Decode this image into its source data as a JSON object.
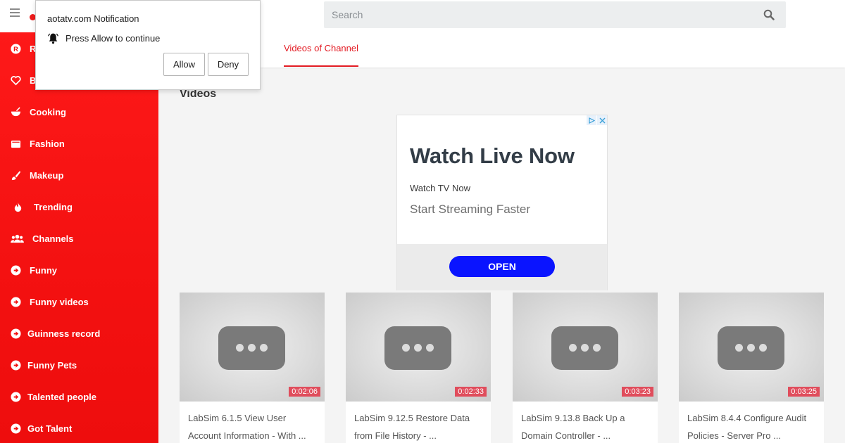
{
  "popup": {
    "title": "aotatv.com Notification",
    "message": "Press Allow to continue",
    "allow_label": "Allow",
    "deny_label": "Deny"
  },
  "search": {
    "placeholder": "Search"
  },
  "tabs": [
    {
      "label": "Videos of Channel",
      "active": true
    }
  ],
  "section_title": "Videos",
  "sidebar": {
    "items": [
      {
        "label": "R",
        "icon": "r-logo-icon"
      },
      {
        "label": "B",
        "icon": "heart-icon"
      },
      {
        "label": "Cooking",
        "icon": "bowl-icon"
      },
      {
        "label": "Fashion",
        "icon": "wallet-icon"
      },
      {
        "label": "Makeup",
        "icon": "brush-icon"
      },
      {
        "label": "Trending",
        "icon": "fire-icon"
      },
      {
        "label": "Channels",
        "icon": "users-icon"
      },
      {
        "label": "Funny",
        "icon": "arrow-circle-icon"
      },
      {
        "label": "Funny videos",
        "icon": "arrow-circle-icon"
      },
      {
        "label": "Guinness record",
        "icon": "arrow-circle-icon"
      },
      {
        "label": "Funny Pets",
        "icon": "arrow-circle-icon"
      },
      {
        "label": "Talented people",
        "icon": "arrow-circle-icon"
      },
      {
        "label": "Got Talent",
        "icon": "arrow-circle-icon"
      }
    ]
  },
  "ad": {
    "headline": "Watch Live Now",
    "sub": "Watch TV Now",
    "desc": "Start Streaming Faster",
    "cta": "OPEN"
  },
  "videos": [
    {
      "duration": "0:02:06",
      "title": "LabSim 6.1.5 View User Account Information - With ..."
    },
    {
      "duration": "0:02:33",
      "title": "LabSim 9.12.5 Restore Data from File History - ..."
    },
    {
      "duration": "0:03:23",
      "title": "LabSim 9.13.8 Back Up a Domain Controller - ..."
    },
    {
      "duration": "0:03:25",
      "title": "LabSim 8.4.4 Configure Audit Policies - Server Pro ..."
    }
  ],
  "colors": {
    "accent": "#e31b23",
    "sidebar": "#f41111",
    "ad_button": "#0a14ff",
    "duration_badge": "#e04d5c"
  }
}
